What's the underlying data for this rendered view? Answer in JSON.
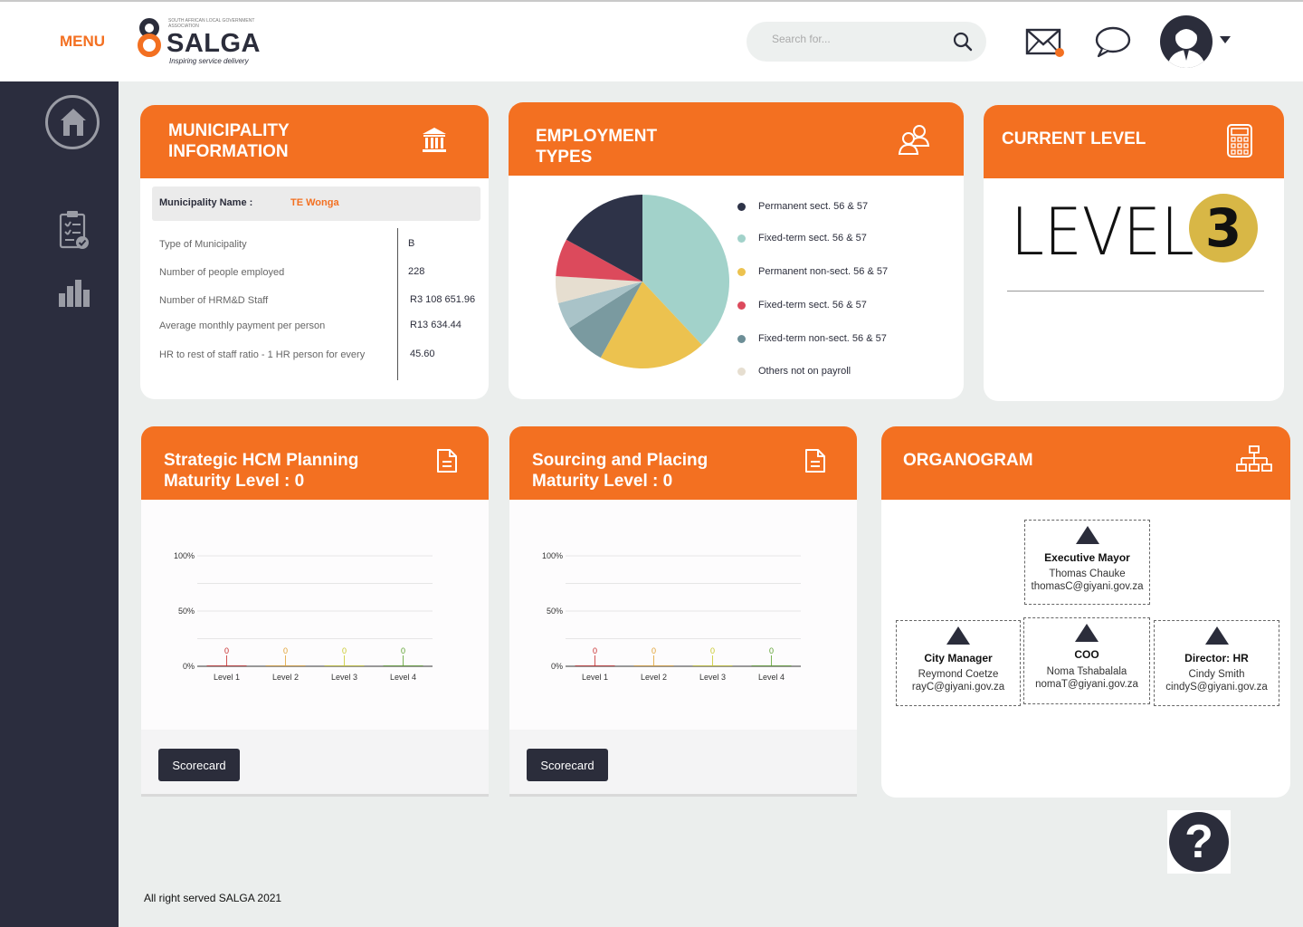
{
  "header": {
    "menu_label": "MENU",
    "logo": {
      "word": "SALGA",
      "tagline": "Inspiring service delivery",
      "small_text": "SOUTH AFRICAN LOCAL GOVERNMENT ASSOCIATION"
    },
    "search_placeholder": "Search for...",
    "icons": [
      "mail-icon",
      "chat-icon",
      "user-avatar-icon",
      "chevron-down-icon"
    ],
    "mail_badge_color": "#f37021"
  },
  "sidebar": {
    "items": [
      {
        "icon": "home-icon"
      },
      {
        "icon": "clipboard-checklist-icon"
      },
      {
        "icon": "bar-chart-icon"
      }
    ]
  },
  "colors": {
    "accent": "#f37021",
    "dark": "#2b2d3b",
    "level_badge": "#d8b746"
  },
  "municipality": {
    "title_line1": "MUNICIPALITY",
    "title_line2": "INFORMATION",
    "icon": "bank-icon",
    "name_label": "Municipality Name :",
    "name_value": "TE Wonga",
    "rows": [
      {
        "label": "Type of Municipality",
        "value": "B"
      },
      {
        "label": "Number of people employed",
        "value": "228"
      },
      {
        "label": "Number of HRM&D Staff",
        "value": "R3 108 651.96"
      },
      {
        "label": "Average monthly payment per person",
        "value": "R13 634.44"
      },
      {
        "label": "HR to rest of staff ratio - 1 HR person for every",
        "value": "45.60"
      }
    ]
  },
  "employment": {
    "title_line1": "EMPLOYMENT",
    "title_line2": "TYPES",
    "icon": "users-group-icon",
    "legend": [
      {
        "label": "Permanent sect.  56 & 57",
        "color": "#2e3348"
      },
      {
        "label": "Fixed-term sect.  56 & 57",
        "color": "#a2d2ca"
      },
      {
        "label": "Permanent  non-sect.  56 & 57",
        "color": "#ecc24f"
      },
      {
        "label": "Fixed-term sect.  56 & 57",
        "color": "#dc4a5c"
      },
      {
        "label": "Fixed-term non-sect.  56 & 57",
        "color": "#6c8e96"
      },
      {
        "label": "Others not on payroll",
        "color": "#e6ded0"
      }
    ]
  },
  "chart_data": [
    {
      "type": "pie",
      "title": "EMPLOYMENT TYPES",
      "slices": [
        {
          "label": "Fixed-term sect.  56 & 57",
          "value": 38,
          "color": "#a2d2ca"
        },
        {
          "label": "Permanent  non-sect.  56 & 57",
          "value": 20,
          "color": "#ecc24f"
        },
        {
          "label": "Fixed-term non-sect.  56 & 57",
          "value": 8,
          "color": "#7a9aa0"
        },
        {
          "label": "Fixed-term non-sect.  56 & 57",
          "value": 5,
          "color": "#a9c3c8"
        },
        {
          "label": "Others not on payroll",
          "value": 5,
          "color": "#e6ded0"
        },
        {
          "label": "Fixed-term sect.  56 & 57",
          "value": 7,
          "color": "#dc4a5c"
        },
        {
          "label": "Permanent sect.  56 & 57",
          "value": 17,
          "color": "#2e3348"
        }
      ]
    },
    {
      "type": "bar",
      "title": "Strategic HCM Planning Maturity Level : 0",
      "categories": [
        "Level 1",
        "Level 2",
        "Level 3",
        "Level 4"
      ],
      "values": [
        0,
        0,
        0,
        0
      ],
      "value_colors": [
        "#c62828",
        "#e0a030",
        "#c8c82a",
        "#5aa02c"
      ],
      "yticks": [
        "100%",
        "50%",
        "0%"
      ],
      "ylim": [
        0,
        100
      ]
    },
    {
      "type": "bar",
      "title": "Sourcing and Placing Maturity Level : 0",
      "categories": [
        "Level 1",
        "Level 2",
        "Level 3",
        "Level 4"
      ],
      "values": [
        0,
        0,
        0,
        0
      ],
      "value_colors": [
        "#c62828",
        "#e0a030",
        "#c8c82a",
        "#5aa02c"
      ],
      "yticks": [
        "100%",
        "50%",
        "0%"
      ],
      "ylim": [
        0,
        100
      ]
    }
  ],
  "level": {
    "title": "CURRENT LEVEL",
    "icon": "calculator-icon",
    "word": "LEVEL",
    "number": "3"
  },
  "strategic": {
    "title_line1": "Strategic HCM Planning",
    "title_line2": "Maturity Level : 0",
    "icon": "document-icon",
    "button": "Scorecard"
  },
  "sourcing": {
    "title_line1": "Sourcing and Placing",
    "title_line2": "Maturity Level : 0",
    "icon": "document-icon",
    "button": "Scorecard"
  },
  "organogram": {
    "title": "ORGANOGRAM",
    "icon": "hierarchy-icon",
    "nodes": [
      {
        "role": "Executive Mayor",
        "name": "Thomas Chauke",
        "email": "thomasC@giyani.gov.za"
      },
      {
        "role": "City Manager",
        "name": "Reymond Coetze",
        "email": "rayC@giyani.gov.za"
      },
      {
        "role": "COO",
        "name": "Noma Tshabalala",
        "email": "nomaT@giyani.gov.za"
      },
      {
        "role": "Director: HR",
        "name": "Cindy Smith",
        "email": "cindyS@giyani.gov.za"
      }
    ]
  },
  "help": {
    "glyph": "?",
    "icon": "help-icon"
  },
  "footer": {
    "text": "All right served SALGA 2021"
  }
}
